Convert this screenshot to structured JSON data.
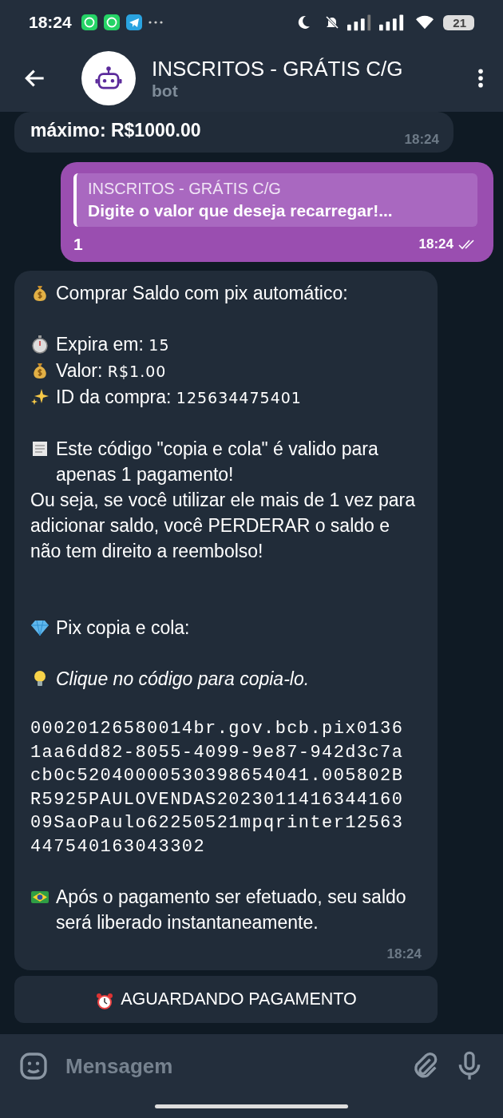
{
  "status_bar": {
    "time": "18:24",
    "battery": "21"
  },
  "header": {
    "title": "INSCRITOS - GRÁTIS C/G",
    "subtitle": "bot"
  },
  "messages": [
    {
      "kind": "incoming",
      "text": "máximo: R$1000.00",
      "time": "18:24"
    },
    {
      "kind": "outgoing",
      "reply_to": {
        "author": "INSCRITOS - GRÁTIS C/G",
        "text": "Digite o valor que deseja recarregar!..."
      },
      "text": "1",
      "time": "18:24",
      "read": true
    },
    {
      "kind": "incoming_rich",
      "time": "18:24",
      "paragraphs": [
        [
          {
            "label": "Comprar Saldo com pix automático:"
          }
        ],
        [
          {
            "label": "Expira em:",
            "value": "15"
          },
          {
            "label": "Valor:",
            "value": "R$1.00"
          },
          {
            "label": "ID da compra:",
            "value": "125634475401"
          }
        ],
        [
          {
            "label": "Este código \"copia e cola\" é valido para apenas 1 pagamento!"
          },
          {
            "label": "Ou seja, se você utilizar ele mais de 1 vez para adicionar saldo, você PERDERAR o saldo e não tem direito a reembolso!"
          }
        ],
        [
          {
            "label": "Pix copia e cola:"
          }
        ],
        [
          {
            "label": "Clique no código para copia-lo."
          }
        ],
        [
          {
            "code": "00020126580014br.gov.bcb.pix01361aa6dd82-8055-4099-9e87-942d3c7acb0c52040000530398654041.005802BR5925PAULOVENDAS202301141634416009SaoPaulo62250521mpqrinter12563447540163043302"
          }
        ],
        [
          {
            "label": "Após o pagamento ser efetuado, seu saldo será liberado instantaneamente."
          }
        ]
      ]
    }
  ],
  "action_button": {
    "label": "AGUARDANDO PAGAMENTO"
  },
  "composer": {
    "placeholder": "Mensagem"
  }
}
